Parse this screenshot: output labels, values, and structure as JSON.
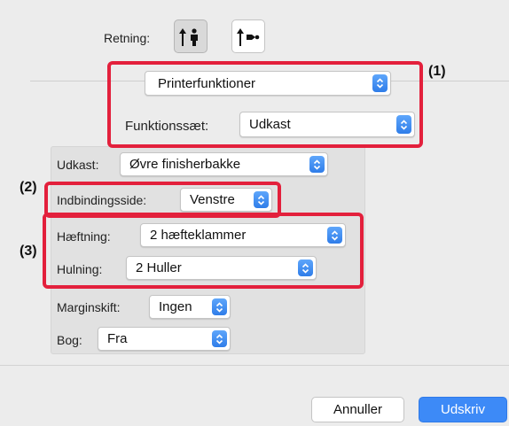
{
  "orientation": {
    "label": "Retning:"
  },
  "panel_menu": {
    "value": "Printerfunktioner"
  },
  "preset": {
    "label": "Funktionssæt:",
    "value": "Udkast"
  },
  "output": {
    "label": "Udkast:",
    "value": "Øvre finisherbakke"
  },
  "binding": {
    "label": "Indbindingsside:",
    "value": "Venstre"
  },
  "staple": {
    "label": "Hæftning:",
    "value": "2 hæfteklammer"
  },
  "punch": {
    "label": "Hulning:",
    "value": "2 Huller"
  },
  "margin_shift": {
    "label": "Marginskift:",
    "value": "Ingen"
  },
  "booklet": {
    "label": "Bog:",
    "value": "Fra"
  },
  "buttons": {
    "cancel": "Annuller",
    "print": "Udskriv"
  },
  "callouts": {
    "c1": "(1)",
    "c2": "(2)",
    "c3": "(3)"
  },
  "colors": {
    "highlight": "#e3203c",
    "accent": "#3d8af7"
  }
}
